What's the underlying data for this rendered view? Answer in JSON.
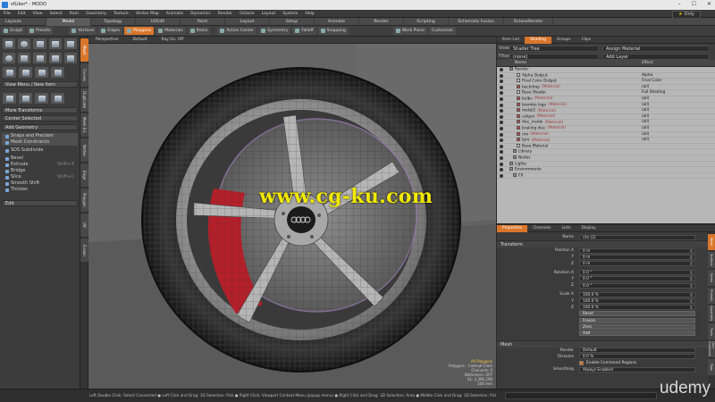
{
  "window": {
    "title": "sfLiker* - MODO",
    "controls": [
      "–",
      "☐",
      "✕"
    ]
  },
  "menubar": {
    "items": [
      "File",
      "Edit",
      "View",
      "Select",
      "Item",
      "Geometry",
      "Texture",
      "Vertex Map",
      "Animate",
      "Dynamics",
      "Render",
      "Octane",
      "Layout",
      "System",
      "Help"
    ],
    "only_label": "Only"
  },
  "layout_tabs": {
    "items": [
      "Layouts",
      "Model",
      "Topology",
      "UVEdit",
      "Paint",
      "Layout",
      "Setup",
      "Animate",
      "Render",
      "Scripting",
      "Schematic Fusion",
      "OctaneRender"
    ],
    "selected_index": 1
  },
  "mode_toolbar": {
    "items": [
      "Sculpt",
      "Presets",
      "Vertices",
      "Edges",
      "Polygons",
      "Materials",
      "Items",
      "Action Center",
      "Symmetry",
      "Falloff",
      "Snapping",
      "Work Plane"
    ],
    "selected_index": 4,
    "right_items": [
      "Work Plane",
      "Customize"
    ]
  },
  "left_panel": {
    "menu_label": "View Menu / New Item",
    "transforms_label": "More Transforms",
    "center_label": "Center Selected",
    "add_geometry": "Add Geometry",
    "tools": [
      {
        "label": "Snaps and Preclam",
        "key": ""
      },
      {
        "label": "Mesh Constraints",
        "key": ""
      },
      {
        "label": "SDS Subdivide",
        "key": ""
      },
      {
        "label": "Bevel",
        "key": ""
      },
      {
        "label": "Extrude",
        "key": "Shift+X"
      },
      {
        "label": "Bridge",
        "key": ""
      },
      {
        "label": "Slice",
        "key": "Shift+C"
      },
      {
        "label": "Smooth Shift",
        "key": ""
      },
      {
        "label": "Thicken",
        "key": ""
      }
    ],
    "edit_label": "Edit"
  },
  "left_vertical_tabs": [
    "Mesh",
    "Curves",
    "Duplicate",
    "Mesh Ed.",
    "Vertex",
    "Edge",
    "Polygon",
    "UV",
    "Fusion"
  ],
  "viewport": {
    "header": [
      "Perspective",
      "Default",
      "Ray GL: Off"
    ],
    "info": [
      "All Polygons",
      "Polygons : Catmull-Clark",
      "Channels: 0",
      "Deformers: OFF",
      "GL: 2,396,298",
      "200 mm"
    ],
    "watermark": "www.cg-ku.com",
    "brand": "udemy"
  },
  "shader_panel": {
    "tabs": [
      "Item List",
      "Shading",
      "Groups",
      "Clips"
    ],
    "selected_tab": 1,
    "view_label": "View",
    "view_value": "Shader Tree",
    "assign_label": "Assign Material",
    "filter_label": "Filter",
    "filter_value": "(none)",
    "add_layer_label": "Add Layer",
    "columns": {
      "name": "Name",
      "effect": "Effect"
    },
    "rows": [
      {
        "name": "Render",
        "material": "",
        "effect": "",
        "color": "#8c8c8c",
        "indent": 10
      },
      {
        "name": "Alpha Output",
        "material": "",
        "effect": "Alpha",
        "color": "#cccccc",
        "indent": 18
      },
      {
        "name": "Final Color Output",
        "material": "",
        "effect": "Final Color",
        "color": "#cccccc",
        "indent": 18
      },
      {
        "name": "backdrop",
        "material": "(Material)",
        "effect": "(all)",
        "color": "#c64545",
        "indent": 18
      },
      {
        "name": "Base Shader",
        "material": "",
        "effect": "Full Shading",
        "color": "#cccccc",
        "indent": 18
      },
      {
        "name": "bulbs",
        "material": "(Material)",
        "effect": "(all)",
        "color": "#c64545",
        "indent": 18
      },
      {
        "name": "brembo logo",
        "material": "(Material)",
        "effect": "(all)",
        "color": "#c64545",
        "indent": 18
      },
      {
        "name": "metal2",
        "material": "(Material)",
        "effect": "(all)",
        "color": "#c64545",
        "indent": 18
      },
      {
        "name": "caliper",
        "material": "(Material)",
        "effect": "(all)",
        "color": "#c64545",
        "indent": 18
      },
      {
        "name": "disc_inside",
        "material": "(Material)",
        "effect": "(all)",
        "color": "#c64545",
        "indent": 18
      },
      {
        "name": "braking disc",
        "material": "(Material)",
        "effect": "(all)",
        "color": "#c64545",
        "indent": 18
      },
      {
        "name": "rim",
        "material": "(Material)",
        "effect": "(all)",
        "color": "#c64545",
        "indent": 18
      },
      {
        "name": "tyre",
        "material": "(Material)",
        "effect": "(all)",
        "color": "#c64545",
        "indent": 18
      },
      {
        "name": "Base Material",
        "material": "",
        "effect": "",
        "color": "#cccccc",
        "indent": 18
      },
      {
        "name": "Library",
        "material": "",
        "effect": "",
        "color": "#8c8c8c",
        "indent": 14
      },
      {
        "name": "Nodes",
        "material": "",
        "effect": "",
        "color": "#8c8c8c",
        "indent": 14
      },
      {
        "name": "Lights",
        "material": "",
        "effect": "",
        "color": "#8c8c8c",
        "indent": 10
      },
      {
        "name": "Environments",
        "material": "",
        "effect": "",
        "color": "#8c8c8c",
        "indent": 10
      },
      {
        "name": "FX",
        "material": "",
        "effect": "",
        "color": "#8c8c8c",
        "indent": 14
      }
    ]
  },
  "properties_panel": {
    "tabs": [
      "Properties",
      "Channels",
      "Lists",
      "Display"
    ],
    "selected_tab": 0,
    "name_label": "Name",
    "name_value": "rim (2)",
    "transform_label": "Transform",
    "rows": [
      {
        "label": "Position X",
        "value": "0 m"
      },
      {
        "label": "Y",
        "value": "0 m"
      },
      {
        "label": "Z",
        "value": "0 m"
      },
      {
        "label": "Rotation X",
        "value": "0.0 °"
      },
      {
        "label": "Y",
        "value": "0.0 °"
      },
      {
        "label": "Z",
        "value": "0.0 °"
      },
      {
        "label": "Scale X",
        "value": "100.0 %"
      },
      {
        "label": "Y",
        "value": "100.0 %"
      },
      {
        "label": "Z",
        "value": "100.0 %"
      }
    ],
    "buttons": [
      "Reset",
      "Freeze",
      "Zero",
      "Add"
    ],
    "mesh_label": "Mesh",
    "render_label": "Render",
    "render_value": "Default",
    "dissolve_label": "Dissolve",
    "dissolve_value": "0.0 %",
    "command_regions": "Enable Command Regions",
    "smoothing_label": "Smoothing",
    "smoothing_value": "Always Enabled",
    "vertical_tabs": [
      "Mesh",
      "Surface",
      "Items",
      "Presets",
      "Assembly",
      "Tools",
      "User Channels",
      "Tags"
    ]
  },
  "status_bar": {
    "text": "Left Double Click: Select Connected ● Left Click and Drag: 3D Selection: Pick ● Right Click: Viewport Context Menu (popup menu) ● Right Click and Drag: 3D Selection: Area ● Middle Click and Drag: 3D Selection: Pick Thro..."
  },
  "colors": {
    "accent": "#d9762b",
    "caliper": "#b3202a",
    "watermark": "#f1e800"
  }
}
